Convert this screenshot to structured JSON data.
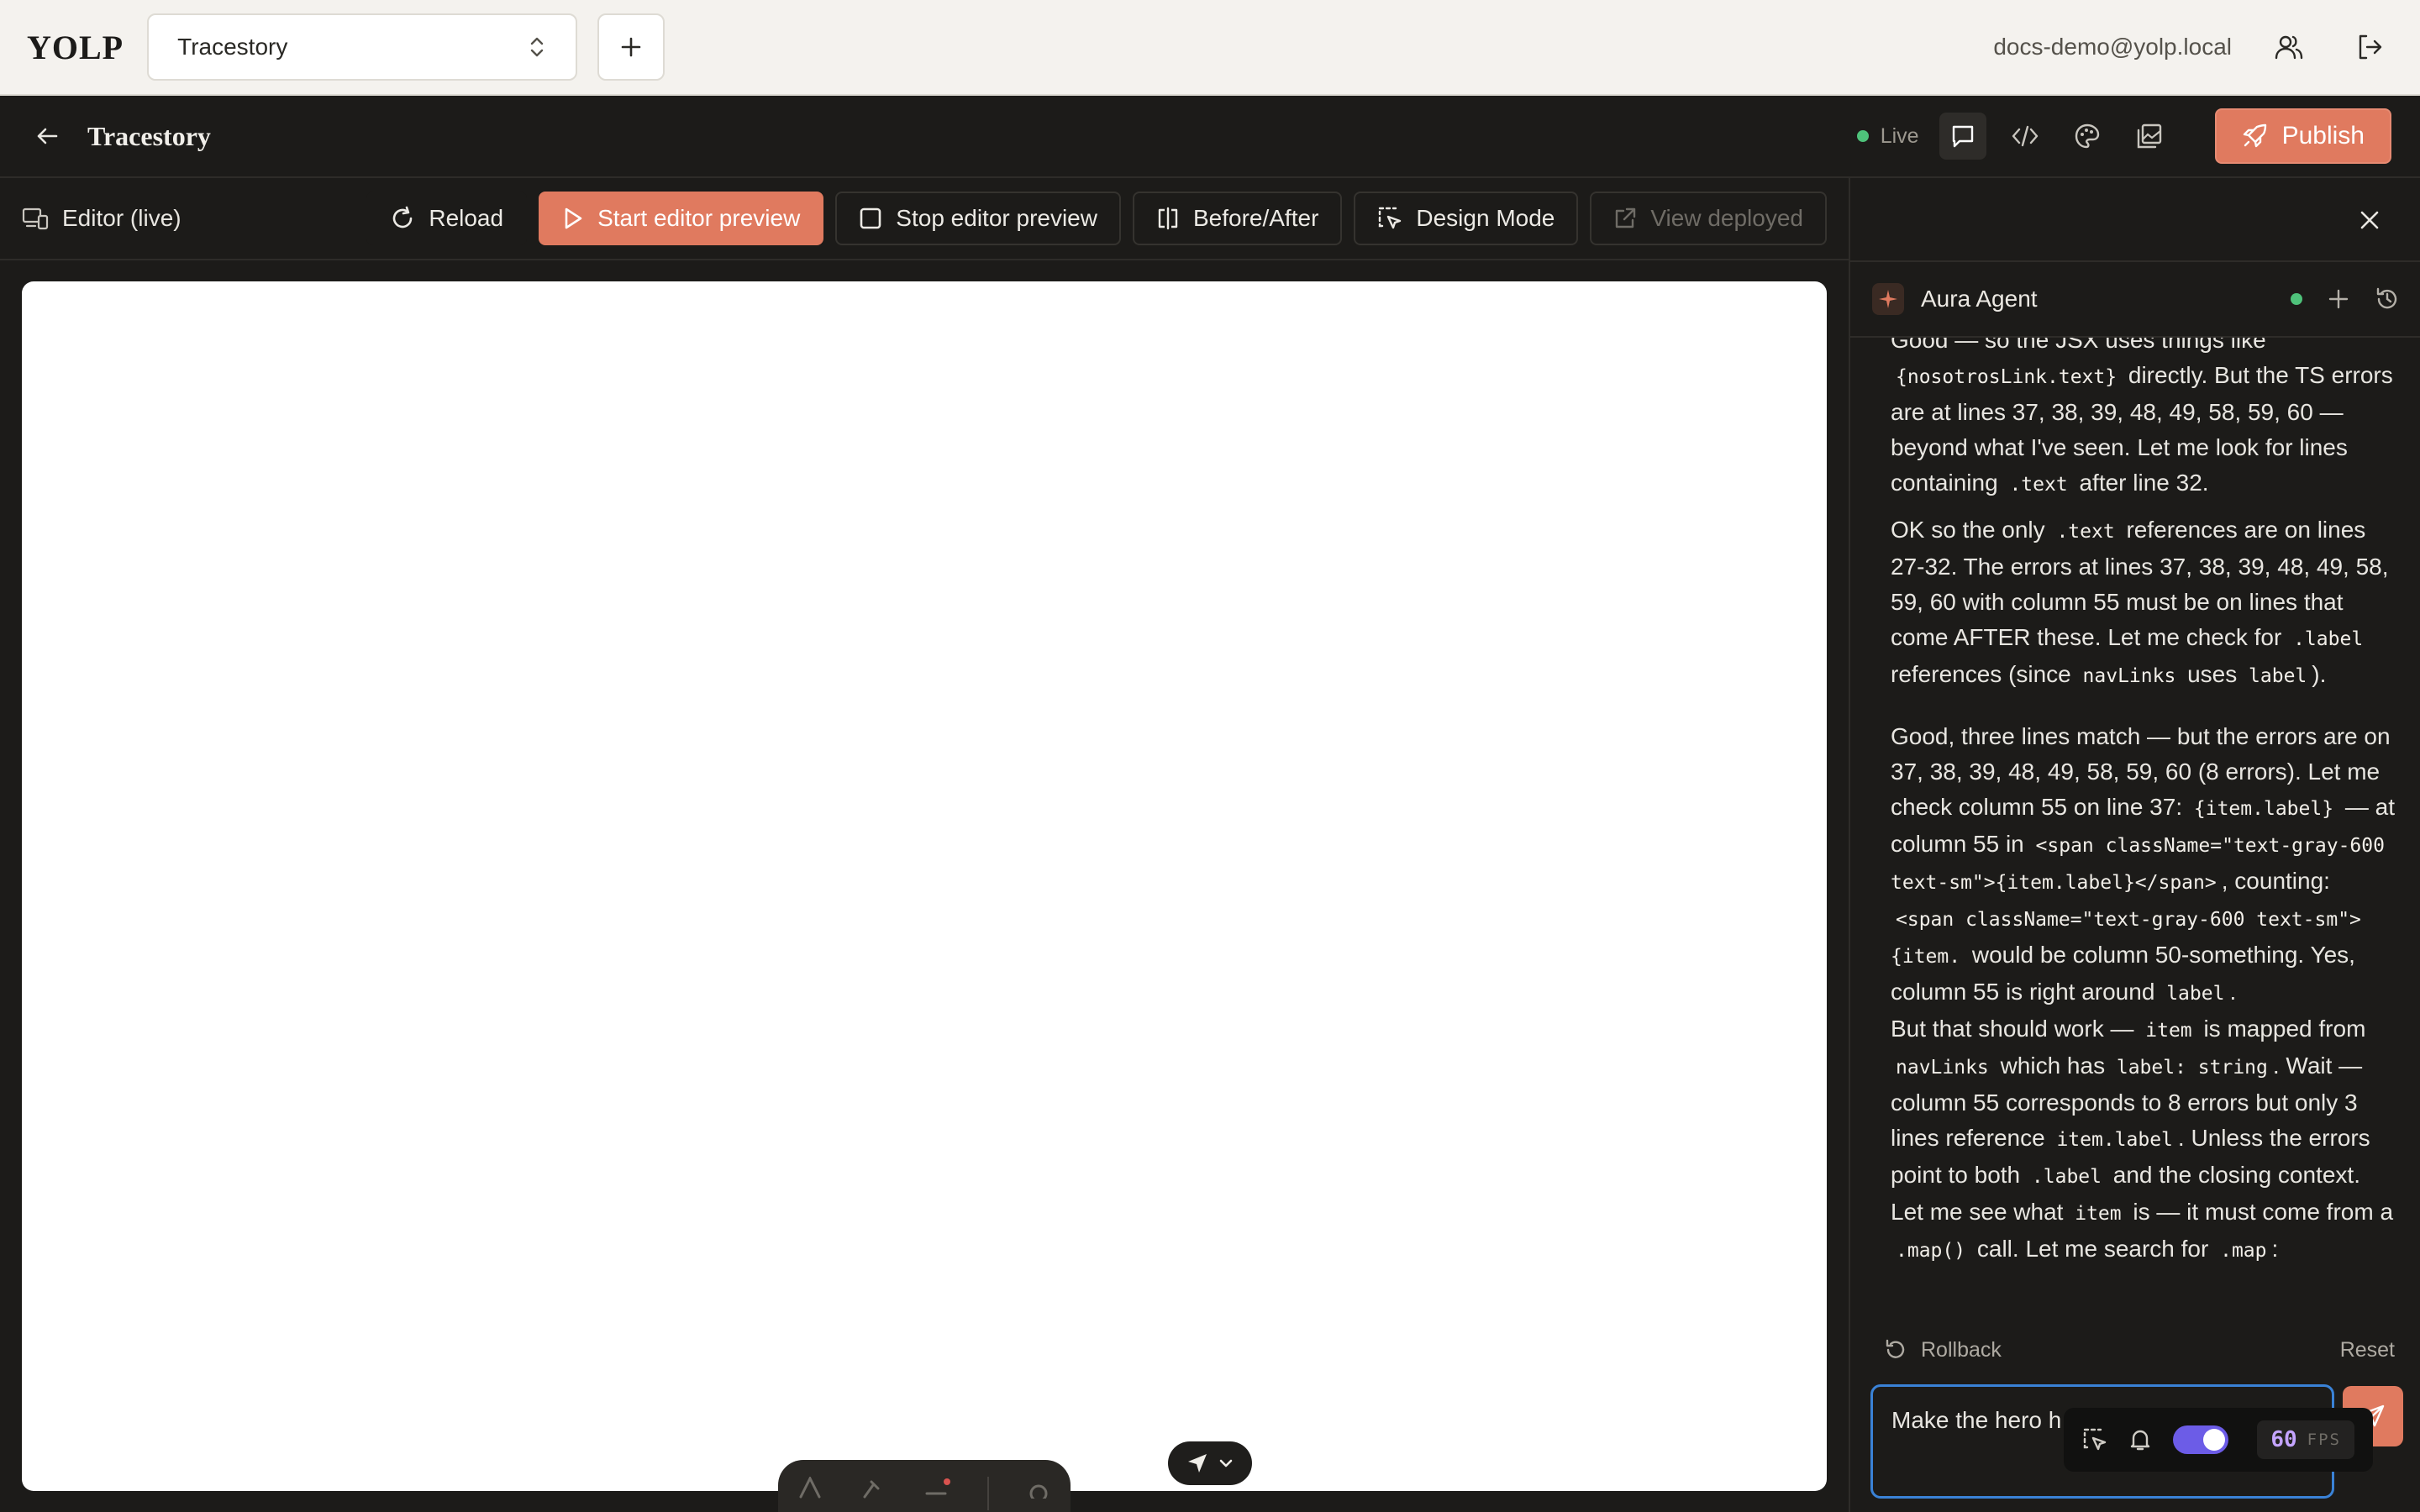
{
  "app": {
    "brand": "YOLP"
  },
  "topbar": {
    "project_select": "Tracestory",
    "user_email": "docs-demo@yolp.local"
  },
  "project": {
    "title": "Tracestory",
    "status": "Live",
    "publish_label": "Publish"
  },
  "editor_toolbar": {
    "mode_label": "Editor (live)",
    "reload": "Reload",
    "start_preview": "Start editor preview",
    "stop_preview": "Stop editor preview",
    "before_after": "Before/After",
    "design_mode": "Design Mode",
    "view_deployed": "View deployed"
  },
  "agent": {
    "name": "Aura Agent",
    "rollback": "Rollback",
    "reset": "Reset",
    "composer_text": "Make the hero h"
  },
  "messages": {
    "p1": {
      "a": "Good — so the JSX uses things like",
      "c1": "{nosotrosLink.text}",
      "b": "directly. But the TS errors are at lines 37, 38, 39, 48, 49, 58, 59, 60 — beyond what I've seen. Let me look for lines containing",
      "c2": ".text",
      "d": "after line 32."
    },
    "p2": {
      "a": "OK so the only",
      "c1": ".text",
      "b": "references are on lines 27-32. The errors at lines 37, 38, 39, 48, 49, 58, 59, 60 with column 55 must be on lines that come AFTER these. Let me check for",
      "c2": ".label",
      "d": "references (since",
      "c3": "navLinks",
      "e": "uses",
      "c4": "label",
      "f": ")."
    },
    "p3": {
      "a": "Good, three lines match — but the errors are on 37, 38, 39, 48, 49, 58, 59, 60 (8 errors). Let me check column 55 on line 37:",
      "c1": "{item.label}",
      "b": "— at column 55 in",
      "c2": "<span className=\"text-gray-600 text-sm\">{item.label}</span>",
      "d": ", counting:",
      "c3": "<span className=\"text-gray-600 text-sm\">{item.",
      "e": "would be column 50-something. Yes, column 55 is right around",
      "c4": "label",
      "f": "."
    },
    "p4": {
      "a": "But that should work —",
      "c1": "item",
      "b": "is mapped from",
      "c2": "navLinks",
      "d": "which has",
      "c3": "label: string",
      "e": ". Wait — column 55 corresponds to 8 errors but only 3 lines reference",
      "c4": "item.label",
      "f": ". Unless the errors point to both",
      "c5": ".label",
      "g": "and the closing context. Let me see what",
      "c6": "item",
      "h": "is — it must come from a",
      "c7": ".map()",
      "i": "call. Let me search for",
      "c8": ".map",
      "j": ":"
    }
  },
  "devbar": {
    "fps": "60",
    "fps_unit": "FPS",
    "toggle_on": true
  },
  "colors": {
    "accent": "#e07a5f",
    "live": "#4ec27a",
    "focus": "#3a82d6",
    "toggle": "#6c5ce7"
  },
  "icons": [
    "chevron-updown-icon",
    "plus-icon",
    "users-icon",
    "logout-icon",
    "arrow-left-icon",
    "chat-icon",
    "code-icon",
    "palette-icon",
    "images-icon",
    "rocket-icon",
    "devices-icon",
    "reload-icon",
    "play-icon",
    "stop-icon",
    "split-icon",
    "select-icon",
    "external-link-icon",
    "close-icon",
    "sparkle-icon",
    "history-icon",
    "undo-icon",
    "send-icon",
    "bell-icon",
    "navigation-icon",
    "chevron-down-icon"
  ]
}
